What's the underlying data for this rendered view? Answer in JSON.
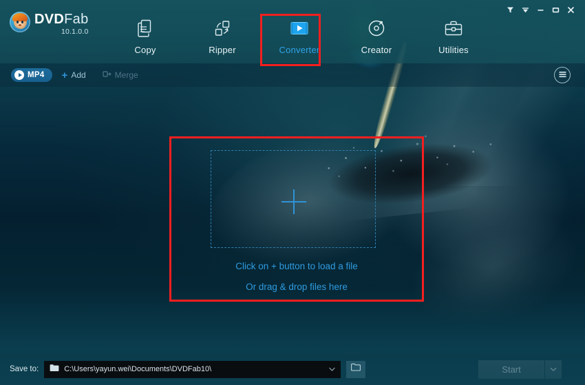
{
  "app": {
    "brand_dvd": "DVD",
    "brand_fab": "Fab",
    "version": "10.1.0.0",
    "accent_color": "#2f9be0",
    "highlight_color": "#f41f1f",
    "header_color": "#15525e",
    "background_color": "#04202f"
  },
  "window_controls": [
    {
      "name": "feedback-icon",
      "glyph": "▼"
    },
    {
      "name": "menu-caret-icon",
      "glyph": "▼"
    },
    {
      "name": "minimize-icon",
      "glyph": "—"
    },
    {
      "name": "maximize-icon",
      "glyph": "▭"
    },
    {
      "name": "close-icon",
      "glyph": "✕"
    }
  ],
  "nav": {
    "tabs": [
      {
        "id": "copy",
        "label": "Copy",
        "icon": "copy-icon",
        "active": false
      },
      {
        "id": "ripper",
        "label": "Ripper",
        "icon": "ripper-icon",
        "active": false
      },
      {
        "id": "converter",
        "label": "Converter",
        "icon": "converter-icon",
        "active": true
      },
      {
        "id": "creator",
        "label": "Creator",
        "icon": "creator-icon",
        "active": false
      },
      {
        "id": "utilities",
        "label": "Utilities",
        "icon": "utilities-icon",
        "active": false
      }
    ]
  },
  "toolbar": {
    "format_chip": "MP4",
    "add_label": "Add",
    "merge_label": "Merge",
    "merge_enabled": false,
    "menu_icon": "hamburger-menu-icon"
  },
  "dropzone": {
    "plus_icon": "plus-icon",
    "line1": "Click on + button to load a file",
    "line2": "Or drag & drop files here"
  },
  "bottom": {
    "save_to_label": "Save to:",
    "save_path": "C:\\Users\\yayun.wei\\Documents\\DVDFab10\\",
    "folder_icon": "folder-icon",
    "dropdown_icon": "caret-down-icon",
    "browse_icon": "browse-folder-icon",
    "start_label": "Start",
    "start_enabled": false,
    "start_caret": "⌄"
  }
}
